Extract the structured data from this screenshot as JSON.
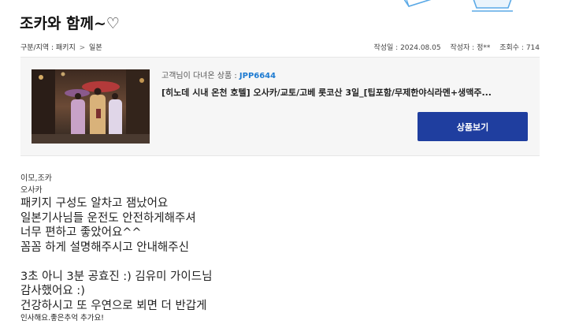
{
  "header": {
    "title": "조카와 함께~♡"
  },
  "meta": {
    "category": "구분/지역 : 패키지",
    "separator": ">",
    "region": "일본",
    "date": "작성일 : 2024.08.05",
    "author": "작성자 : 정**",
    "views": "조회수 : 714"
  },
  "product": {
    "code_label": "고객님이 다녀온 상품 : ",
    "code": "JPP6644",
    "name": "[히노데 시내 온천 호텔] 오사카/교토/고베 롯코산 3일_[팁포함/무제한야식라멘+생맥주...",
    "button_label": "상품보기",
    "thumbnail_icon": "kimono-street-photo"
  },
  "review": {
    "line_1": "이모,조카",
    "line_2": "오사카",
    "line_3": "패키지 구성도 알차고  잼났어요",
    "line_4": "일본기사님들 운전도 안전하게해주셔",
    "line_5": "너무 편하고 좋았어요^^",
    "line_6": "꼼꼼 하게  설명해주시고 안내해주신",
    "line_7": "3초 아니 3분 공효진 :) 김유미 가이드님",
    "line_8": "감사했어요 :)",
    "line_9": "건강하시고 또 우연으로 뵈면 더 반갑게",
    "line_10": "인사해요.좋은추억 추가요!"
  },
  "colors": {
    "button_bg": "#1f3e9f",
    "code_color": "#1e7bd1",
    "card_bg": "#f6f6f6",
    "decoration_stroke": "#5aa9e6"
  }
}
